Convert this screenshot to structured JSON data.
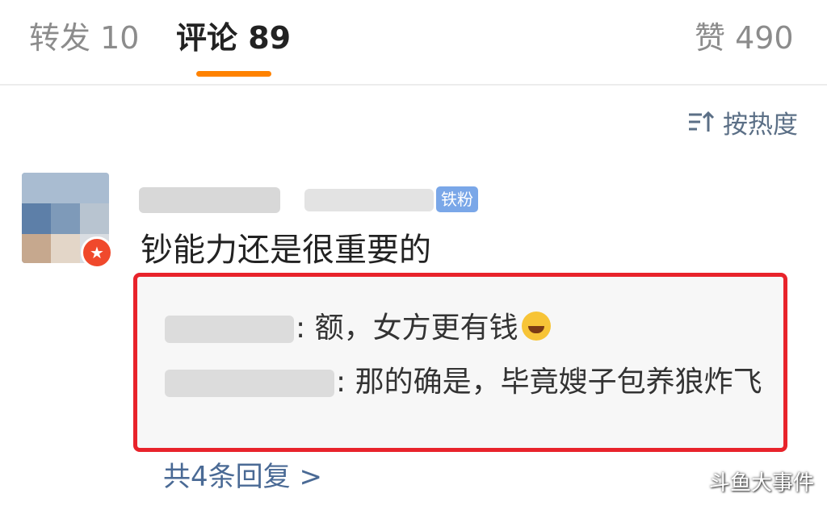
{
  "tabs": [
    {
      "label": "转发 10"
    },
    {
      "label": "评论 89"
    },
    {
      "label": "赞 490"
    }
  ],
  "colors": {
    "accent": "#ff8200",
    "highlight_border": "#e8232b",
    "link": "#4a6a95"
  },
  "sort": {
    "label": "按热度",
    "icon": "sort-icon"
  },
  "comment": {
    "fan_badge": "铁粉",
    "text": "钞能力还是很重要的",
    "avatar_badge_icon": "verified-v-icon",
    "replies": [
      {
        "text": ": 额，女方更有钱",
        "emoji": "laugh-cry-emoji"
      },
      {
        "text": ": 那的确是，毕竟嫂子包养狼炸飞"
      }
    ],
    "more_replies": "共4条回复 >"
  },
  "watermark": "斗鱼大事件"
}
